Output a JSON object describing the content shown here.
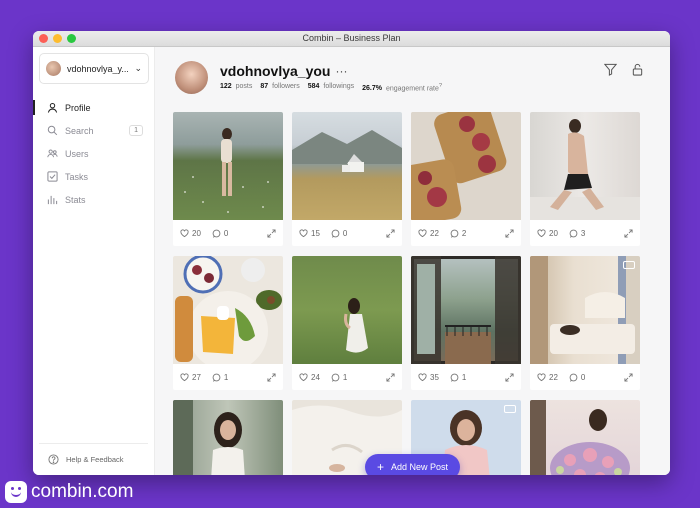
{
  "window": {
    "title": "Combin  – Business Plan"
  },
  "sidebar": {
    "account": {
      "name": "vdohnovlya_y..."
    },
    "items": [
      {
        "label": "Profile",
        "icon": "user-icon",
        "active": true
      },
      {
        "label": "Search",
        "icon": "search-icon",
        "badge": "1"
      },
      {
        "label": "Users",
        "icon": "users-icon"
      },
      {
        "label": "Tasks",
        "icon": "checkbox-icon"
      },
      {
        "label": "Stats",
        "icon": "bar-chart-icon"
      }
    ],
    "help": "Help & Feedback"
  },
  "profile": {
    "username": "vdohnovlya_you",
    "more": "···",
    "posts": "122",
    "posts_label": "posts",
    "followers": "87",
    "followers_label": "followers",
    "followings": "584",
    "followings_label": "followings",
    "engagement": "26.7%",
    "engagement_label": "engagement rate"
  },
  "posts": [
    {
      "likes": "20",
      "comments": "0"
    },
    {
      "likes": "15",
      "comments": "0"
    },
    {
      "likes": "22",
      "comments": "2"
    },
    {
      "likes": "20",
      "comments": "3"
    },
    {
      "likes": "27",
      "comments": "1"
    },
    {
      "likes": "24",
      "comments": "1"
    },
    {
      "likes": "35",
      "comments": "1"
    },
    {
      "likes": "22",
      "comments": "0",
      "video": true
    },
    {
      "likes": "",
      "comments": ""
    },
    {
      "likes": "",
      "comments": ""
    },
    {
      "likes": "",
      "comments": "",
      "video": true
    },
    {
      "likes": "",
      "comments": ""
    }
  ],
  "add_button": {
    "label": "Add New Post"
  },
  "brand": {
    "name": "combin.com"
  },
  "colors": {
    "background": "#6b35c9",
    "accent": "#5a4ae3"
  }
}
